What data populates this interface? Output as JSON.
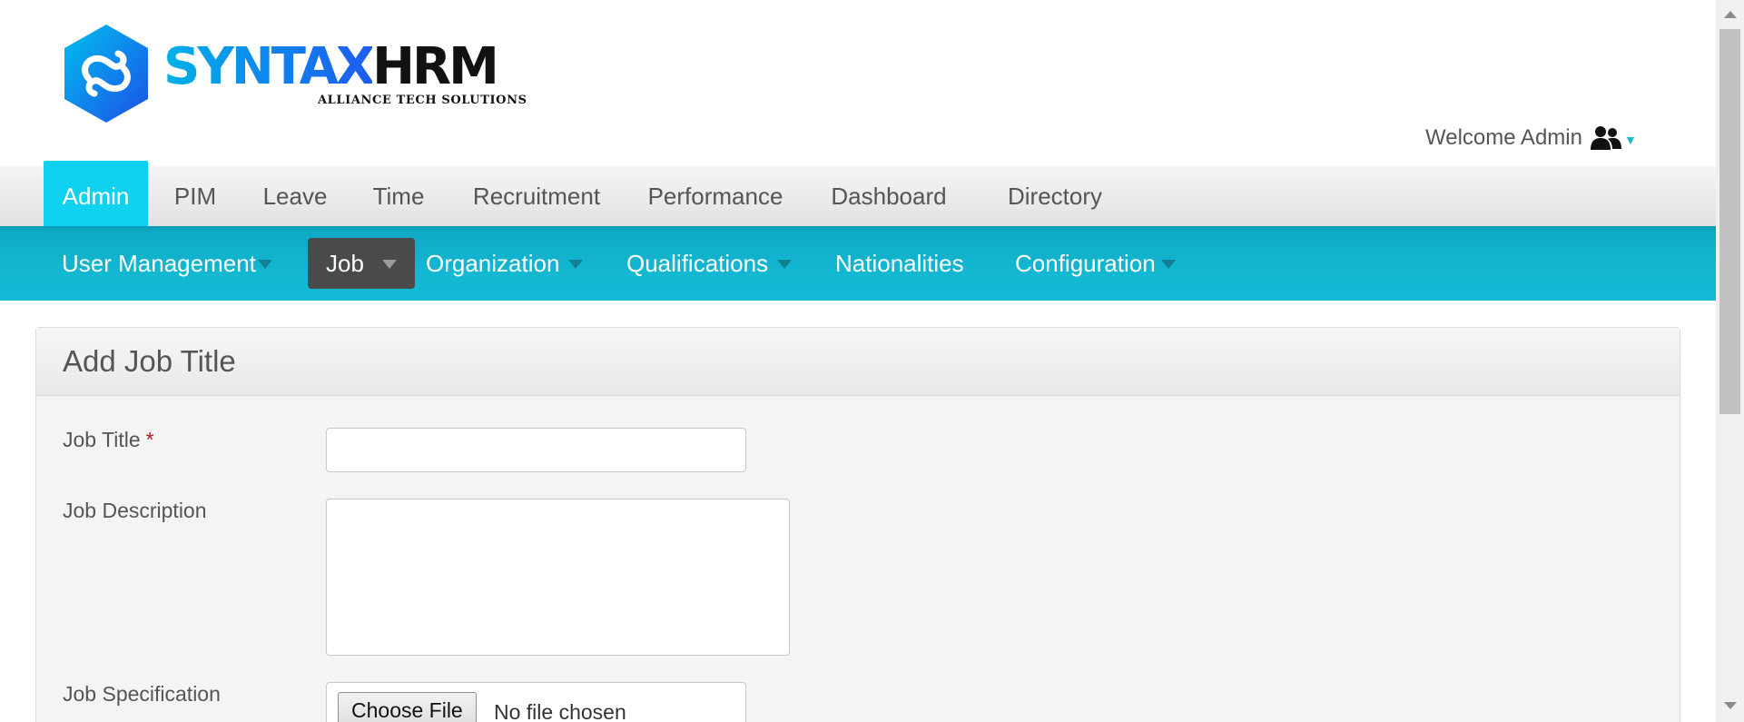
{
  "logo": {
    "brand_part1": "SYNTAX",
    "brand_part2": "HRM",
    "tagline": "ALLIANCE TECH SOLUTIONS"
  },
  "user": {
    "welcome_text": "Welcome Admin",
    "icon": "users-icon"
  },
  "main_nav": {
    "active": "Admin",
    "tabs": [
      "Admin",
      "PIM",
      "Leave",
      "Time",
      "Recruitment",
      "Performance",
      "Dashboard",
      "Directory"
    ]
  },
  "sub_nav": {
    "active": "Job",
    "items": [
      {
        "label": "User Management",
        "has_dropdown": true
      },
      {
        "label": "Job",
        "has_dropdown": true
      },
      {
        "label": "Organization",
        "has_dropdown": true
      },
      {
        "label": "Qualifications",
        "has_dropdown": true
      },
      {
        "label": "Nationalities",
        "has_dropdown": false
      },
      {
        "label": "Configuration",
        "has_dropdown": true
      }
    ]
  },
  "form": {
    "title": "Add Job Title",
    "job_title_label": "Job Title",
    "required_marker": "*",
    "job_title_value": "",
    "job_description_label": "Job Description",
    "job_description_value": "",
    "job_specification_label": "Job Specification",
    "file_button_label": "Choose File",
    "file_status": "No file chosen"
  },
  "colors": {
    "accent_cyan": "#10d2f0",
    "subnav_teal": "#13b7d2",
    "active_subnav": "#4a4a4a",
    "required": "#b22222"
  }
}
